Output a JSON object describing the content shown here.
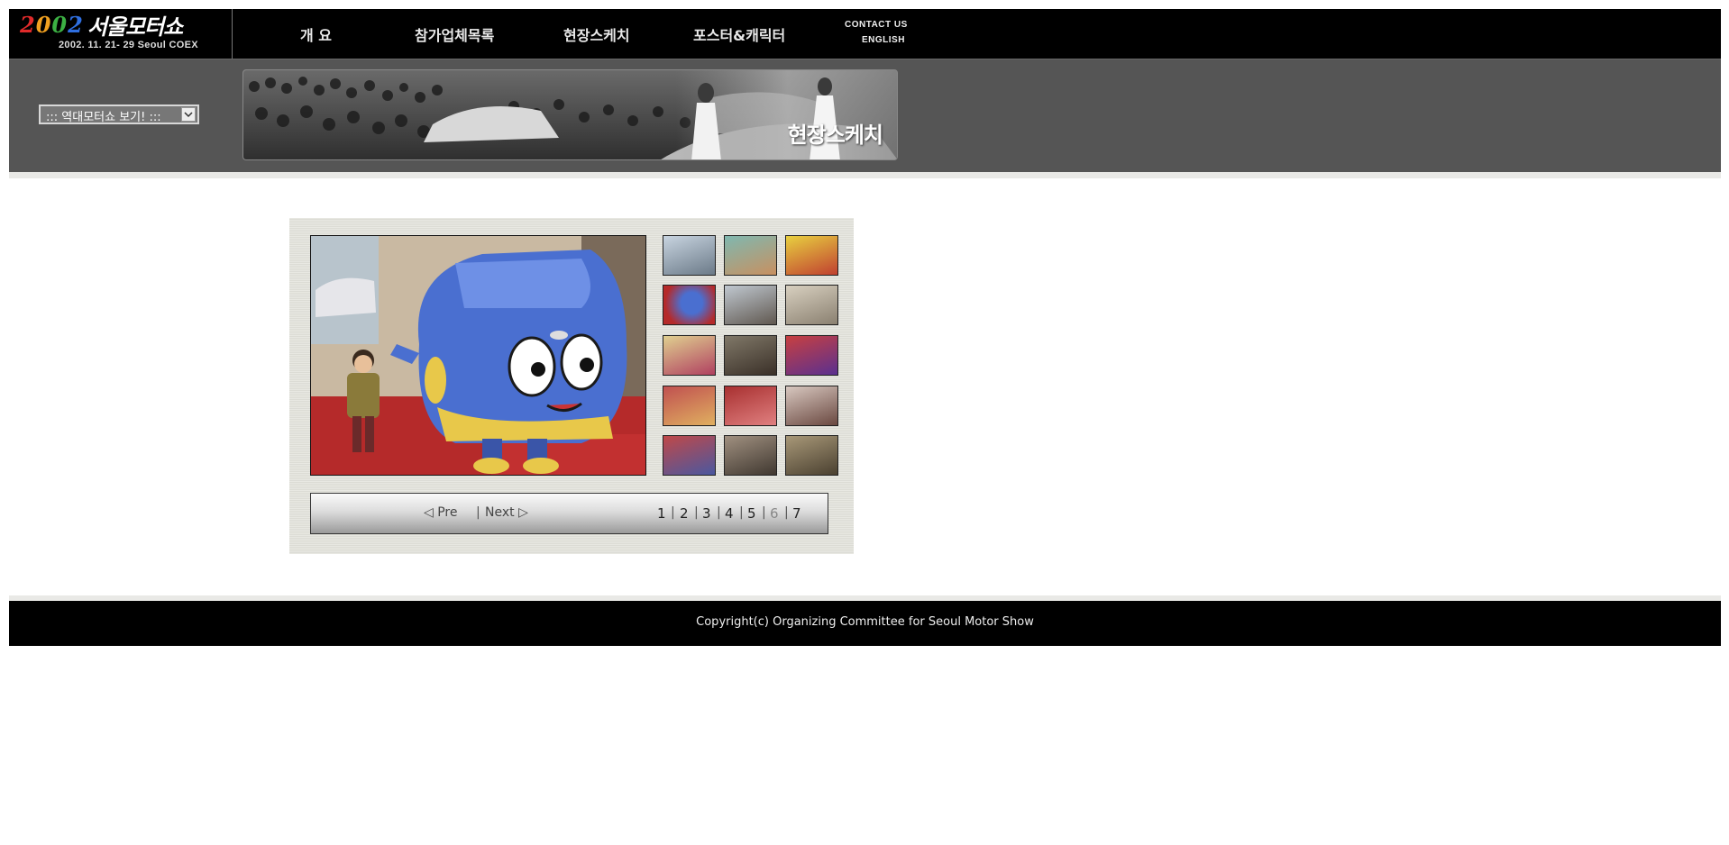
{
  "header": {
    "logo": {
      "year_digits": [
        "2",
        "0",
        "0",
        "2"
      ],
      "title": "서울모터쇼",
      "date_line": "2002. 11. 21- 29   Seoul COEX"
    },
    "menu": [
      {
        "label": "개 요"
      },
      {
        "label": "참가업체목록"
      },
      {
        "label": "현장스케치"
      },
      {
        "label": "포스터&캐릭터"
      }
    ],
    "contact_label": "CONTACT US",
    "english_label": "ENGLISH"
  },
  "banner": {
    "history_select_value": "::: 역대모터쇼 보기! :::",
    "title": "현장스케치"
  },
  "gallery": {
    "thumbnail_count": 15,
    "pager": {
      "prev_label": "◁ Pre",
      "next_label": "Next ▷",
      "pages": [
        "1",
        "2",
        "3",
        "4",
        "5",
        "6",
        "7"
      ],
      "current_page": "6"
    }
  },
  "footer": {
    "copyright": "Copyright(c) Organizing Committee for Seoul Motor Show"
  },
  "colors": {
    "topbar_bg": "#000000",
    "band_bg": "#555555",
    "gallery_bg": "#e2e2dc",
    "footer_bg": "#000000"
  }
}
